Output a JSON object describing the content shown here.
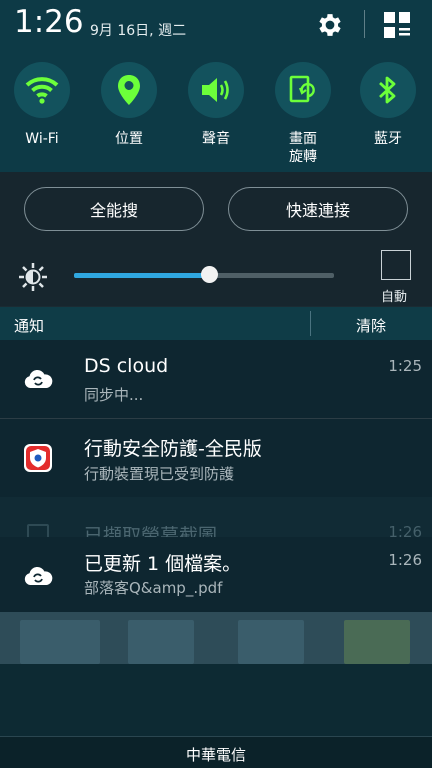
{
  "status": {
    "time": "1:26",
    "date": "9月 16日, 週二",
    "settings_icon": "gear-icon",
    "edit_icon": "grid-edit-icon"
  },
  "quick_settings": [
    {
      "label": "Wi-Fi",
      "icon": "wifi-icon"
    },
    {
      "label": "位置",
      "icon": "location-pin-icon"
    },
    {
      "label": "聲音",
      "icon": "speaker-icon"
    },
    {
      "label": "畫面\n旋轉",
      "label_line1": "畫面",
      "label_line2": "旋轉",
      "icon": "screen-rotation-icon"
    },
    {
      "label": "藍牙",
      "icon": "bluetooth-icon"
    }
  ],
  "buttons": {
    "search": "全能搜",
    "quick_connect": "快速連接"
  },
  "brightness": {
    "level": 0.52,
    "auto_label": "自動",
    "auto_checked": false
  },
  "notifications_header": {
    "title": "通知",
    "clear": "清除"
  },
  "notifications": [
    {
      "title": "DS cloud",
      "subtitle": "同步中...",
      "time": "1:25",
      "icon": "cloud-sync-icon"
    },
    {
      "title": "行動安全防護-全民版",
      "subtitle": "行動裝置現已受到防護",
      "time": "",
      "icon": "security-shield-icon"
    },
    {
      "title": "已擷取螢幕截圖",
      "subtitle": "",
      "time": "1:26",
      "icon": "screenshot-icon"
    },
    {
      "title": "已更新 1 個檔案。",
      "subtitle": "部落客Q&amp_.pdf",
      "time": "1:26",
      "icon": "cloud-sync-icon"
    }
  ],
  "carrier": "中華電信",
  "colors": {
    "accent": "#2fa7e0",
    "qs_icon": "#6cff3a",
    "panel": "#0d3a46"
  }
}
